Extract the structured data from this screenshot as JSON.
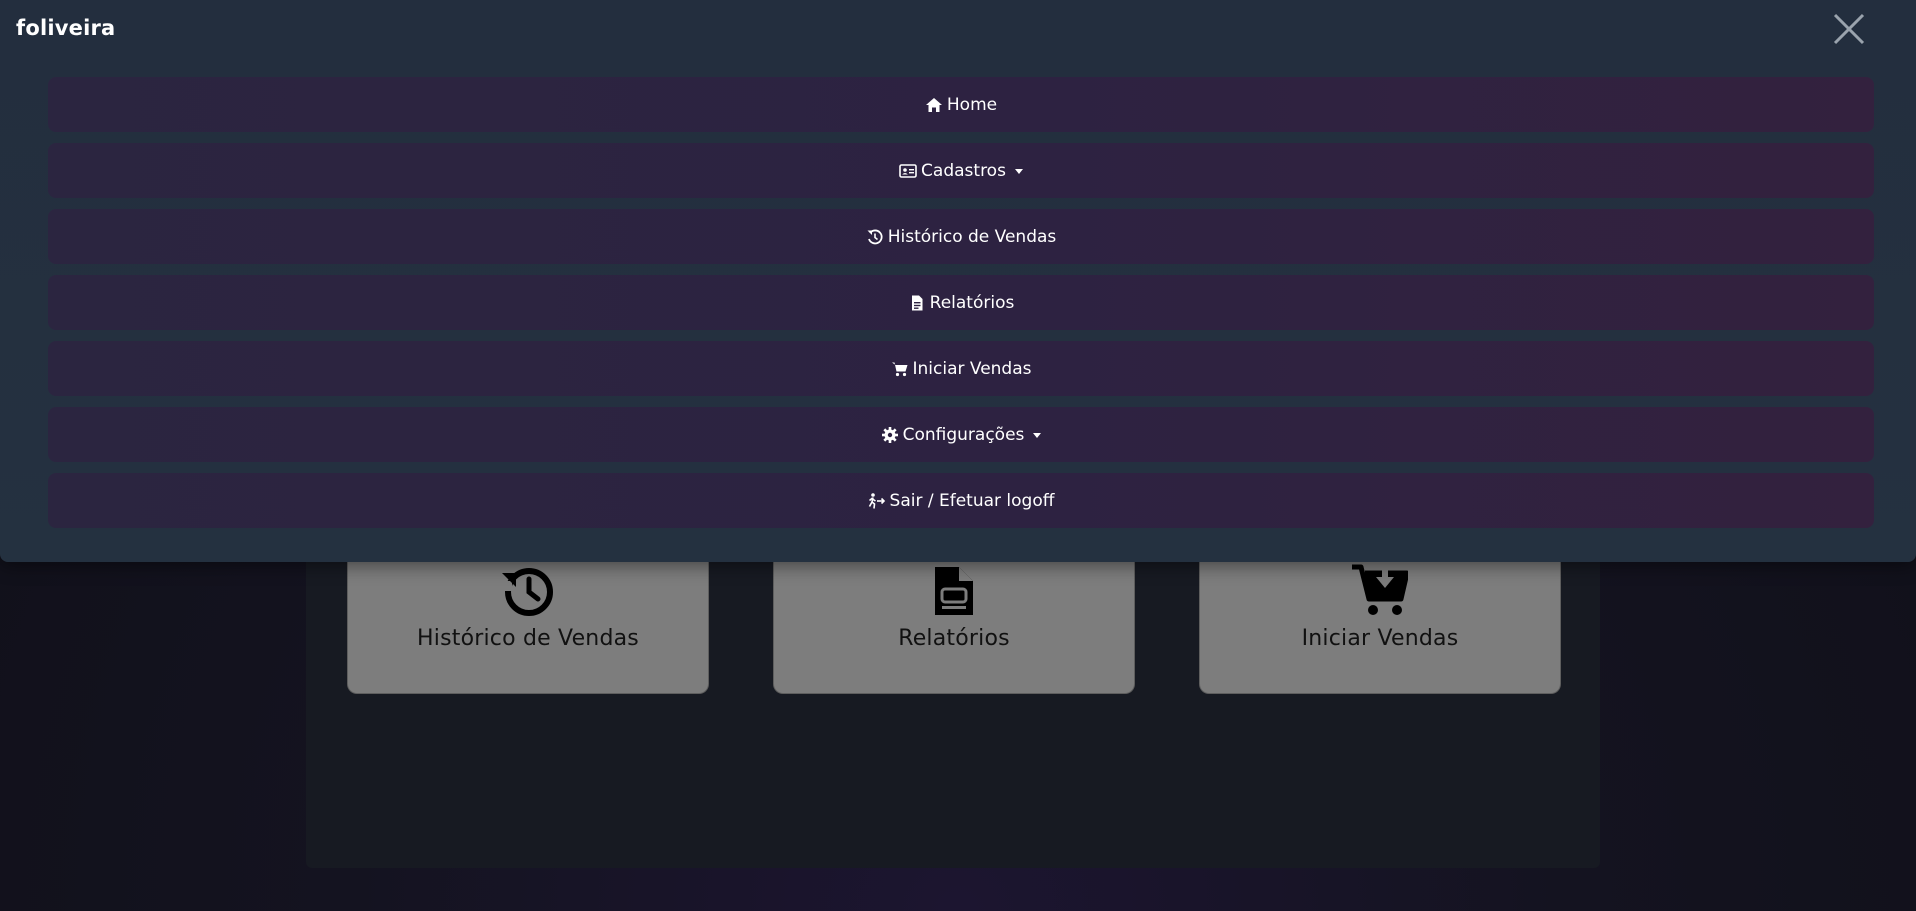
{
  "app": {
    "brand": "foliveira"
  },
  "menu": {
    "items": [
      {
        "label": "Home",
        "icon": "home-icon",
        "dropdown": false
      },
      {
        "label": "Cadastros",
        "icon": "id-card-icon",
        "dropdown": true
      },
      {
        "label": "Histórico de Vendas",
        "icon": "history-icon",
        "dropdown": false
      },
      {
        "label": "Relatórios",
        "icon": "file-icon",
        "dropdown": false
      },
      {
        "label": "Iniciar Vendas",
        "icon": "cart-icon",
        "dropdown": false
      },
      {
        "label": "Configurações",
        "icon": "gear-icon",
        "dropdown": true
      },
      {
        "label": "Sair / Efetuar logoff",
        "icon": "exit-icon",
        "dropdown": false
      }
    ]
  },
  "cards": [
    {
      "label": "Histórico de Vendas",
      "icon": "history-icon"
    },
    {
      "label": "Relatórios",
      "icon": "file-icon"
    },
    {
      "label": "Iniciar Vendas",
      "icon": "cart-download-icon"
    }
  ],
  "colors": {
    "overlay": "#232e3e",
    "menu_item": "#2d2241",
    "card": "#7d7d7d",
    "background": "#141320"
  }
}
